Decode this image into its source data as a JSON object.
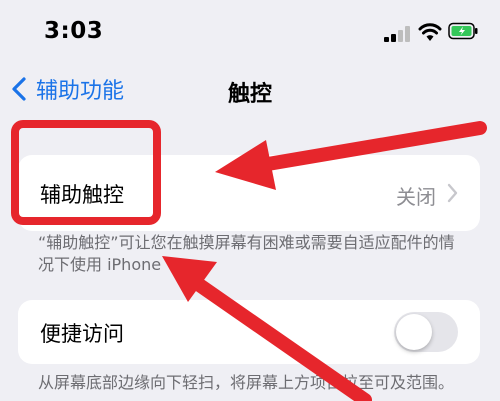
{
  "status_bar": {
    "time": "3:03"
  },
  "nav": {
    "back_label": "辅助功能",
    "title": "触控"
  },
  "assistive_touch": {
    "label": "辅助触控",
    "value": "关闭",
    "footer": "“辅助触控”可让您在触摸屏幕有困难或需要自适应配件的情况下使用 iPhone"
  },
  "reachability": {
    "label": "便捷访问",
    "enabled": false,
    "footer": "从屏幕底部边缘向下轻扫，将屏幕上方项目拉至可及范围。"
  },
  "colors": {
    "accent": "#1a73e8",
    "battery_fill": "#34c759",
    "annotation": "#e6262c",
    "secondary_text": "#8e8e93"
  },
  "icons": [
    "signal-icon",
    "wifi-icon",
    "battery-icon",
    "chevron-left-icon",
    "chevron-right-icon"
  ]
}
